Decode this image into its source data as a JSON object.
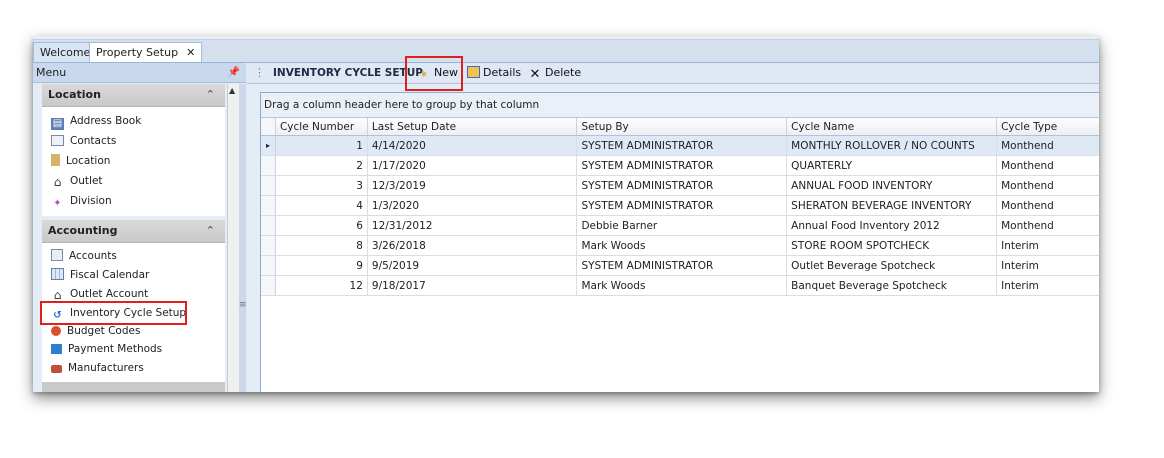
{
  "tabs": [
    {
      "label": "Welcome"
    },
    {
      "label": "Property Setup",
      "close": "✕"
    }
  ],
  "menu": {
    "title": "Menu",
    "pin_icon": "pin-icon",
    "groups": [
      {
        "title": "Location",
        "items": [
          {
            "label": "Address Book",
            "icon": "address-book-icon"
          },
          {
            "label": "Contacts",
            "icon": "contacts-icon"
          },
          {
            "label": "Location",
            "icon": "location-icon"
          },
          {
            "label": "Outlet",
            "icon": "house-icon"
          },
          {
            "label": "Division",
            "icon": "division-icon"
          }
        ]
      },
      {
        "title": "Accounting",
        "items": [
          {
            "label": "Accounts",
            "icon": "accounts-icon"
          },
          {
            "label": "Fiscal Calendar",
            "icon": "calendar-icon"
          },
          {
            "label": "Outlet Account",
            "icon": "house-icon"
          },
          {
            "label": "Inventory Cycle Setup",
            "icon": "cycle-icon",
            "selected": true
          },
          {
            "label": "Budget Codes",
            "icon": "budget-icon"
          },
          {
            "label": "Payment Methods",
            "icon": "payment-icon"
          },
          {
            "label": "Manufacturers",
            "icon": "manufacturer-icon"
          }
        ]
      }
    ]
  },
  "toolbar": {
    "title": "INVENTORY CYCLE SETUP",
    "new_label": "New",
    "details_label": "Details",
    "delete_label": "Delete"
  },
  "grid": {
    "group_hint": "Drag a column header here to group by that column",
    "columns": [
      "Cycle Number",
      "Last Setup Date",
      "Setup By",
      "Cycle Name",
      "Cycle Type"
    ],
    "rows": [
      {
        "number": "1",
        "date": "4/14/2020",
        "by": "SYSTEM ADMINISTRATOR",
        "name": "MONTHLY ROLLOVER / NO COUNTS",
        "type": "Monthend",
        "selected": true
      },
      {
        "number": "2",
        "date": "1/17/2020",
        "by": "SYSTEM ADMINISTRATOR",
        "name": "QUARTERLY",
        "type": "Monthend"
      },
      {
        "number": "3",
        "date": "12/3/2019",
        "by": "SYSTEM ADMINISTRATOR",
        "name": "ANNUAL FOOD INVENTORY",
        "type": "Monthend"
      },
      {
        "number": "4",
        "date": "1/3/2020",
        "by": "SYSTEM ADMINISTRATOR",
        "name": "SHERATON BEVERAGE INVENTORY",
        "type": "Monthend"
      },
      {
        "number": "6",
        "date": "12/31/2012",
        "by": "Debbie Barner",
        "name": "Annual Food Inventory 2012",
        "type": "Monthend"
      },
      {
        "number": "8",
        "date": "3/26/2018",
        "by": "Mark Woods",
        "name": "STORE ROOM SPOTCHECK",
        "type": "Interim"
      },
      {
        "number": "9",
        "date": "9/5/2019",
        "by": "SYSTEM ADMINISTRATOR",
        "name": "Outlet Beverage Spotcheck",
        "type": "Interim"
      },
      {
        "number": "12",
        "date": "9/18/2017",
        "by": "Mark Woods",
        "name": "Banquet Beverage Spotcheck",
        "type": "Interim"
      }
    ]
  },
  "colors": {
    "highlight": "#e02020",
    "selected_row": "#dfe9f6"
  }
}
